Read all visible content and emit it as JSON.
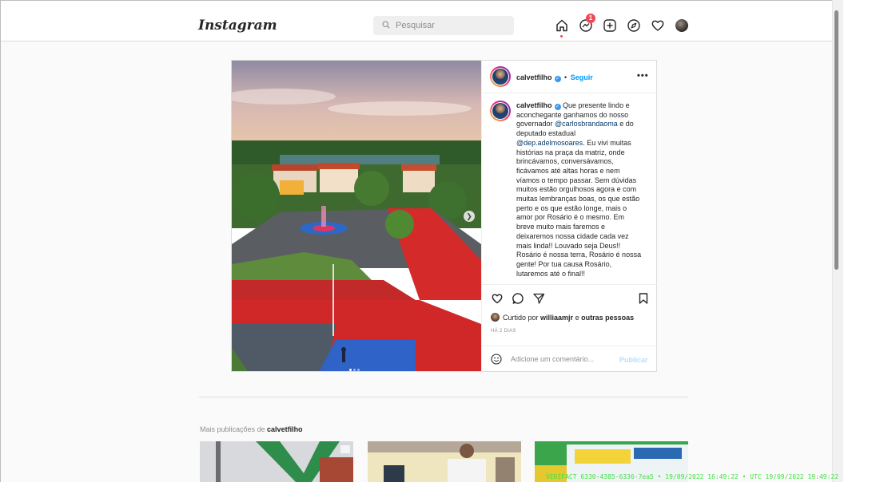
{
  "header": {
    "logo": "Instagram",
    "search_placeholder": "Pesquisar",
    "notification_count": "1",
    "icons": [
      "home-icon",
      "messenger-icon",
      "new-post-icon",
      "explore-icon",
      "activity-heart-icon",
      "profile-avatar"
    ]
  },
  "post": {
    "username": "calvetfilho",
    "follow_label": "Seguir",
    "separator": "•",
    "more_label": "•••",
    "caption_parts": {
      "text1": " Que presente lindo e aconchegante ganhamos do nosso governador ",
      "mention1": "@carlosbrandaoma",
      "text2": " e do deputado estadual ",
      "mention2": "@dep.adelmosoares",
      "text3": ". Eu vivi muitas histórias na praça da matriz, onde brincávamos, conversávamos, ficávamos até altas horas e nem víamos o tempo passar. Sem dúvidas muitos estão orgulhosos agora e com muitas lembranças boas, os que estão perto e os que estão longe, mais o amor por Rosário é o mesmo. Em breve muito mais faremos e deixaremos nossa cidade cada vez mais linda!! Louvado seja Deus!! Rosário é nossa terra, Rosário é nossa gente! Por tua causa Rosário, lutaremos até o final!!"
    },
    "likes": {
      "prefix": "Curtido por ",
      "user": "williaamjr",
      "middle": " e ",
      "others": "outras pessoas"
    },
    "time_ago": "HÁ 2 DIAS",
    "comment_placeholder": "Adicione um comentário...",
    "publish_label": "Publicar",
    "carousel": {
      "total": 3,
      "current": 1
    }
  },
  "more_posts": {
    "prefix": "Mais publicações de ",
    "user": "calvetfilho"
  },
  "watermark": "VERIFACT 6330-4385-6336-7ea5 • 19/09/2022 16:49:22 • UTC 19/09/2022 19:49:22",
  "colors": {
    "accent": "#0095f6",
    "badge": "#ed4956",
    "watermark": "#44e044"
  }
}
